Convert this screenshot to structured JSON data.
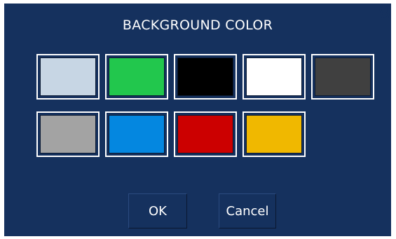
{
  "dialog": {
    "title": "BACKGROUND COLOR"
  },
  "swatches": [
    {
      "color": "#c7d6e4"
    },
    {
      "color": "#22c74d"
    },
    {
      "color": "#000000"
    },
    {
      "color": "#ffffff"
    },
    {
      "color": "#404040"
    },
    {
      "color": "#a3a3a3"
    },
    {
      "color": "#0487e0"
    },
    {
      "color": "#cc0000"
    },
    {
      "color": "#f0b800"
    }
  ],
  "buttons": {
    "ok_label": "OK",
    "cancel_label": "Cancel"
  },
  "colors": {
    "dialog_background": "#15315e",
    "swatch_border": "#ffffff",
    "text": "#ffffff"
  }
}
